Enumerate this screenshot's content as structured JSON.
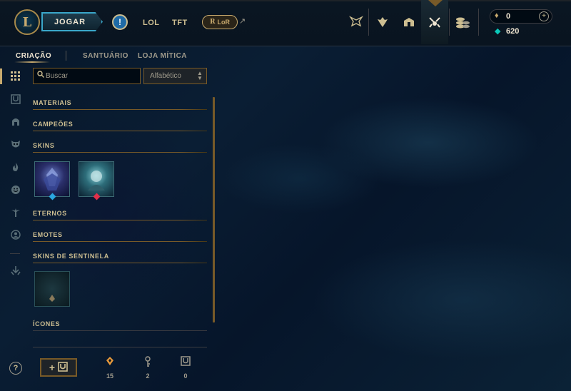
{
  "topbar": {
    "logo_letter": "L",
    "play_label": "JOGAR",
    "alert_label": "!",
    "nav": [
      "LOL",
      "TFT"
    ],
    "lor_label": "LoR",
    "lor_external": "↗",
    "icons": [
      "trophy-icon",
      "chest-icon",
      "collection-icon",
      "loot-icon",
      "store-icon"
    ],
    "rp": "0",
    "rp_add": "+",
    "blue_essence": "620"
  },
  "subnav": {
    "items": [
      "CRIAÇÃO",
      "SANTUÁRIO",
      "LOJA MÍTICA"
    ],
    "active": "CRIAÇÃO"
  },
  "rail": {
    "icons": [
      "grid-icon",
      "chest-icon",
      "helmet-icon",
      "mask-icon",
      "flame-icon",
      "emote-icon",
      "ward-icon",
      "profile-icon",
      "disenchant-icon"
    ]
  },
  "filters": {
    "search_placeholder": "Buscar",
    "sort_value": "Alfabético"
  },
  "sections": {
    "materials": "MATERIAIS",
    "champions": "CAMPEÕES",
    "skins": "SKINS",
    "eternals": "ETERNOS",
    "emotes": "EMOTES",
    "ward_skins": "SKINS DE SENTINELA",
    "icons": "ÍCONES"
  },
  "footer": {
    "help": "?",
    "add_plus": "+",
    "orange_essence": "15",
    "keys": "2",
    "chests": "0"
  },
  "colors": {
    "gold": "#c8aa6e",
    "gold_dark": "#785a28",
    "teal": "#0ac8b9",
    "text": "#cdbe91",
    "orange": "#e89a3c"
  }
}
